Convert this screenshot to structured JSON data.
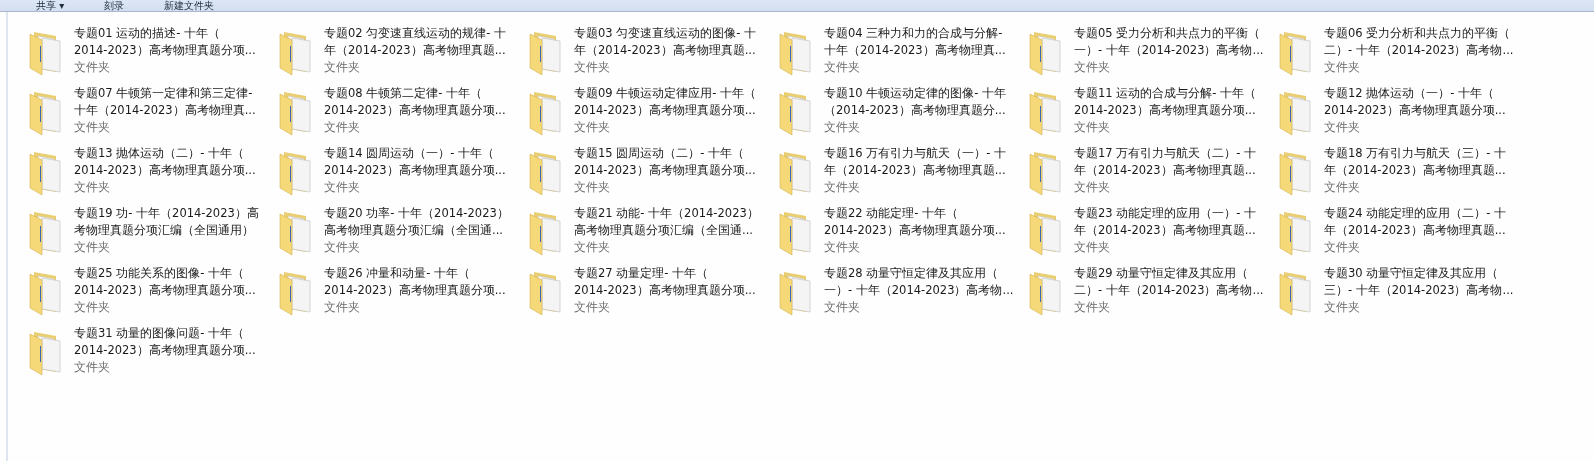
{
  "toolbar": [
    {
      "label": "共享 ▾"
    },
    {
      "label": "刻录"
    },
    {
      "label": "新建文件夹"
    }
  ],
  "items": [
    {
      "lines": [
        "专题01 运动的描述- 十年（",
        "2014-2023）高考物理真题分项..."
      ],
      "type": "文件夹"
    },
    {
      "lines": [
        "专题02 匀变速直线运动的规律- 十",
        "年（2014-2023）高考物理真题..."
      ],
      "type": "文件夹"
    },
    {
      "lines": [
        "专题03 匀变速直线运动的图像- 十",
        "年（2014-2023）高考物理真题..."
      ],
      "type": "文件夹"
    },
    {
      "lines": [
        "专题04 三种力和力的合成与分解-",
        "十年（2014-2023）高考物理真..."
      ],
      "type": "文件夹"
    },
    {
      "lines": [
        "专题05 受力分析和共点力的平衡（",
        "一）- 十年（2014-2023）高考物..."
      ],
      "type": "文件夹"
    },
    {
      "lines": [
        "专题06 受力分析和共点力的平衡（",
        "二）- 十年（2014-2023）高考物..."
      ],
      "type": "文件夹"
    },
    {
      "lines": [
        "专题07 牛顿第一定律和第三定律-",
        "十年（2014-2023）高考物理真..."
      ],
      "type": "文件夹"
    },
    {
      "lines": [
        "专题08 牛顿第二定律- 十年（",
        "2014-2023）高考物理真题分项..."
      ],
      "type": "文件夹"
    },
    {
      "lines": [
        "专题09 牛顿运动定律应用- 十年（",
        "2014-2023）高考物理真题分项..."
      ],
      "type": "文件夹"
    },
    {
      "lines": [
        "专题10 牛顿运动定律的图像- 十年",
        "（2014-2023）高考物理真题分..."
      ],
      "type": "文件夹"
    },
    {
      "lines": [
        "专题11 运动的合成与分解- 十年（",
        "2014-2023）高考物理真题分项..."
      ],
      "type": "文件夹"
    },
    {
      "lines": [
        "专题12 抛体运动（一）- 十年（",
        "2014-2023）高考物理真题分项..."
      ],
      "type": "文件夹"
    },
    {
      "lines": [
        "专题13 抛体运动（二）- 十年（",
        "2014-2023）高考物理真题分项..."
      ],
      "type": "文件夹"
    },
    {
      "lines": [
        "专题14 圆周运动（一）- 十年（",
        "2014-2023）高考物理真题分项..."
      ],
      "type": "文件夹"
    },
    {
      "lines": [
        "专题15 圆周运动（二）- 十年（",
        "2014-2023）高考物理真题分项..."
      ],
      "type": "文件夹"
    },
    {
      "lines": [
        "专题16 万有引力与航天（一）- 十",
        "年（2014-2023）高考物理真题..."
      ],
      "type": "文件夹"
    },
    {
      "lines": [
        "专题17 万有引力与航天（二）- 十",
        "年（2014-2023）高考物理真题..."
      ],
      "type": "文件夹"
    },
    {
      "lines": [
        "专题18 万有引力与航天（三）- 十",
        "年（2014-2023）高考物理真题..."
      ],
      "type": "文件夹"
    },
    {
      "lines": [
        "专题19 功- 十年（2014-2023）高",
        "考物理真题分项汇编（全国通用）"
      ],
      "type": "文件夹"
    },
    {
      "lines": [
        "专题20 功率- 十年（2014-2023）",
        "高考物理真题分项汇编（全国通..."
      ],
      "type": "文件夹"
    },
    {
      "lines": [
        "专题21 动能- 十年（2014-2023）",
        "高考物理真题分项汇编（全国通..."
      ],
      "type": "文件夹"
    },
    {
      "lines": [
        "专题22 动能定理- 十年（",
        "2014-2023）高考物理真题分项..."
      ],
      "type": "文件夹"
    },
    {
      "lines": [
        "专题23 动能定理的应用（一）- 十",
        "年（2014-2023）高考物理真题..."
      ],
      "type": "文件夹"
    },
    {
      "lines": [
        "专题24 动能定理的应用（二）- 十",
        "年（2014-2023）高考物理真题..."
      ],
      "type": "文件夹"
    },
    {
      "lines": [
        "专题25 功能关系的图像- 十年（",
        "2014-2023）高考物理真题分项..."
      ],
      "type": "文件夹"
    },
    {
      "lines": [
        "专题26 冲量和动量- 十年（",
        "2014-2023）高考物理真题分项..."
      ],
      "type": "文件夹"
    },
    {
      "lines": [
        "专题27 动量定理- 十年（",
        "2014-2023）高考物理真题分项..."
      ],
      "type": "文件夹"
    },
    {
      "lines": [
        "专题28 动量守恒定律及其应用（",
        "一）- 十年（2014-2023）高考物..."
      ],
      "type": "文件夹"
    },
    {
      "lines": [
        "专题29 动量守恒定律及其应用（",
        "二）- 十年（2014-2023）高考物..."
      ],
      "type": "文件夹"
    },
    {
      "lines": [
        "专题30 动量守恒定律及其应用（",
        "三）- 十年（2014-2023）高考物..."
      ],
      "type": "文件夹"
    },
    {
      "lines": [
        "专题31 动量的图像问题- 十年（",
        "2014-2023）高考物理真题分项..."
      ],
      "type": "文件夹"
    }
  ]
}
